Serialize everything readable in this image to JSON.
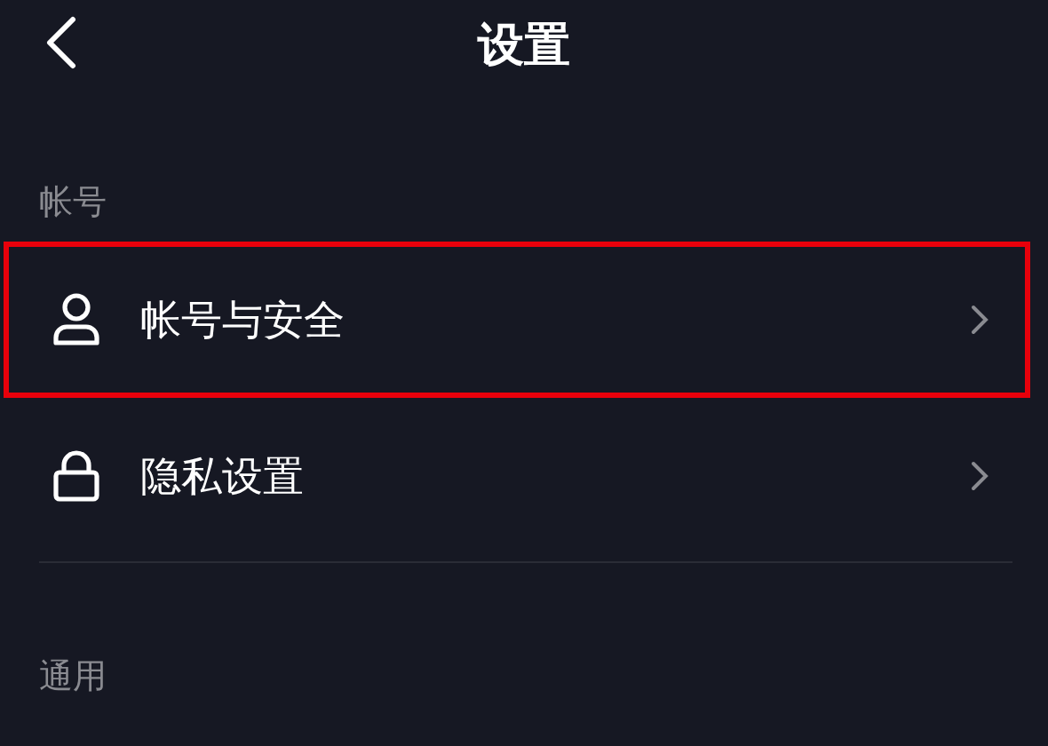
{
  "header": {
    "title": "设置"
  },
  "sections": [
    {
      "title": "帐号",
      "items": [
        {
          "label": "帐号与安全",
          "kind": "account",
          "highlighted": true
        },
        {
          "label": "隐私设置",
          "kind": "privacy",
          "highlighted": false
        }
      ]
    },
    {
      "title": "通用"
    }
  ]
}
